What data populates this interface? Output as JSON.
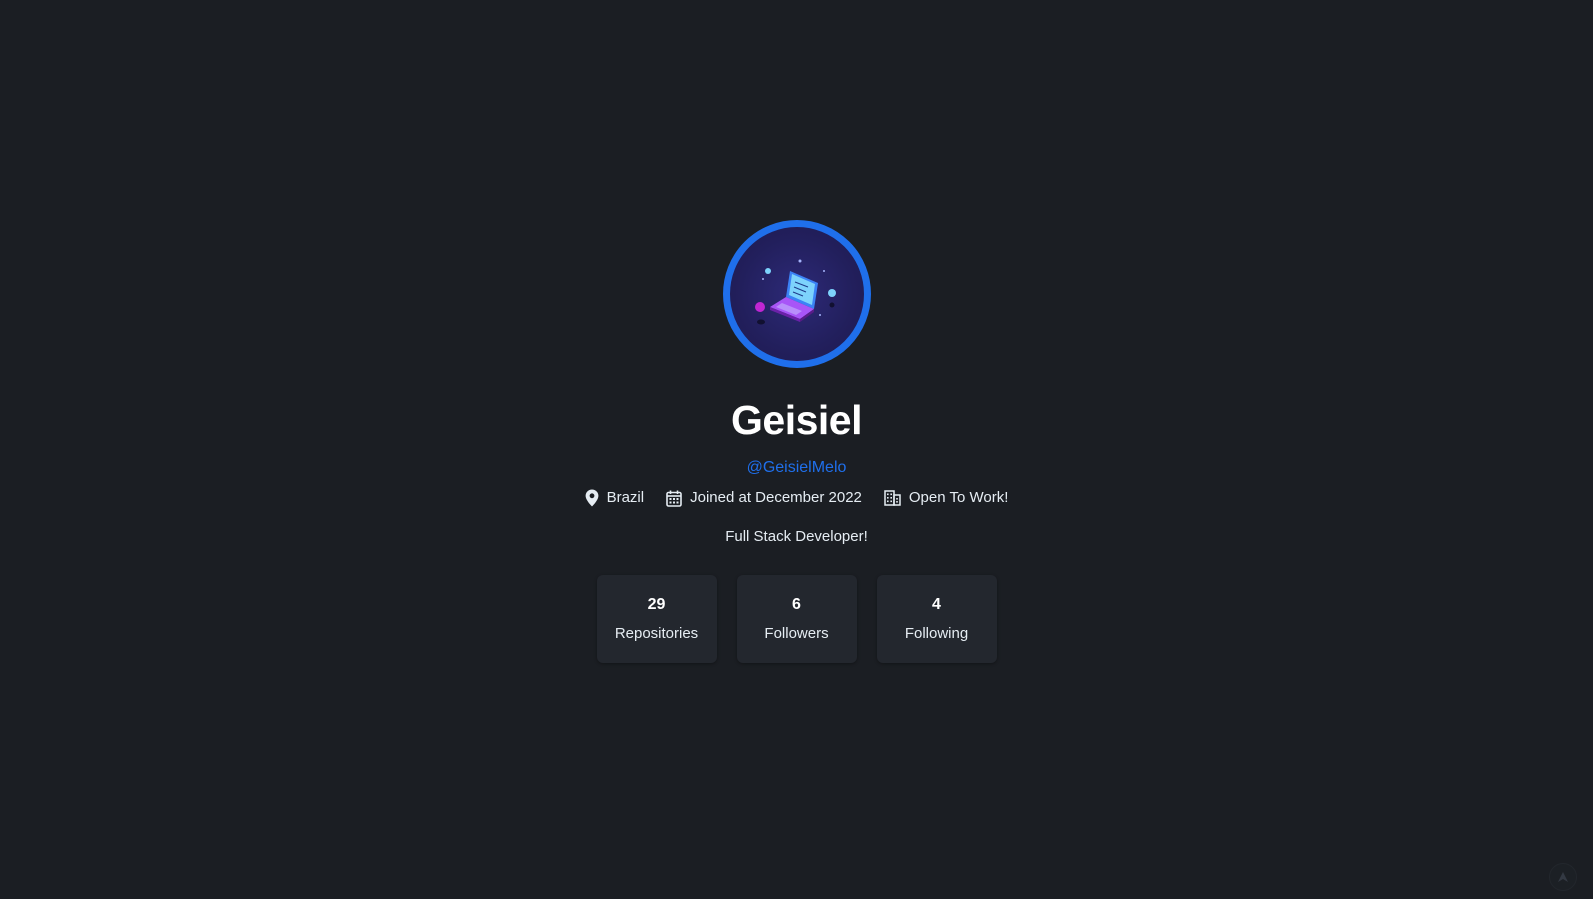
{
  "profile": {
    "name": "Geisiel",
    "login": "@GeisielMelo",
    "location": "Brazil",
    "joined": "Joined at December 2022",
    "company": "Open To Work!",
    "bio": "Full Stack Developer!",
    "avatar_icon": "laptop-illustration-icon"
  },
  "stats": [
    {
      "value": "29",
      "label": "Repositories"
    },
    {
      "value": "6",
      "label": "Followers"
    },
    {
      "value": "4",
      "label": "Following"
    }
  ],
  "colors": {
    "background": "#1b1e23",
    "accent": "#1f6feb",
    "card": "#23272e",
    "text": "#e6edf3"
  }
}
